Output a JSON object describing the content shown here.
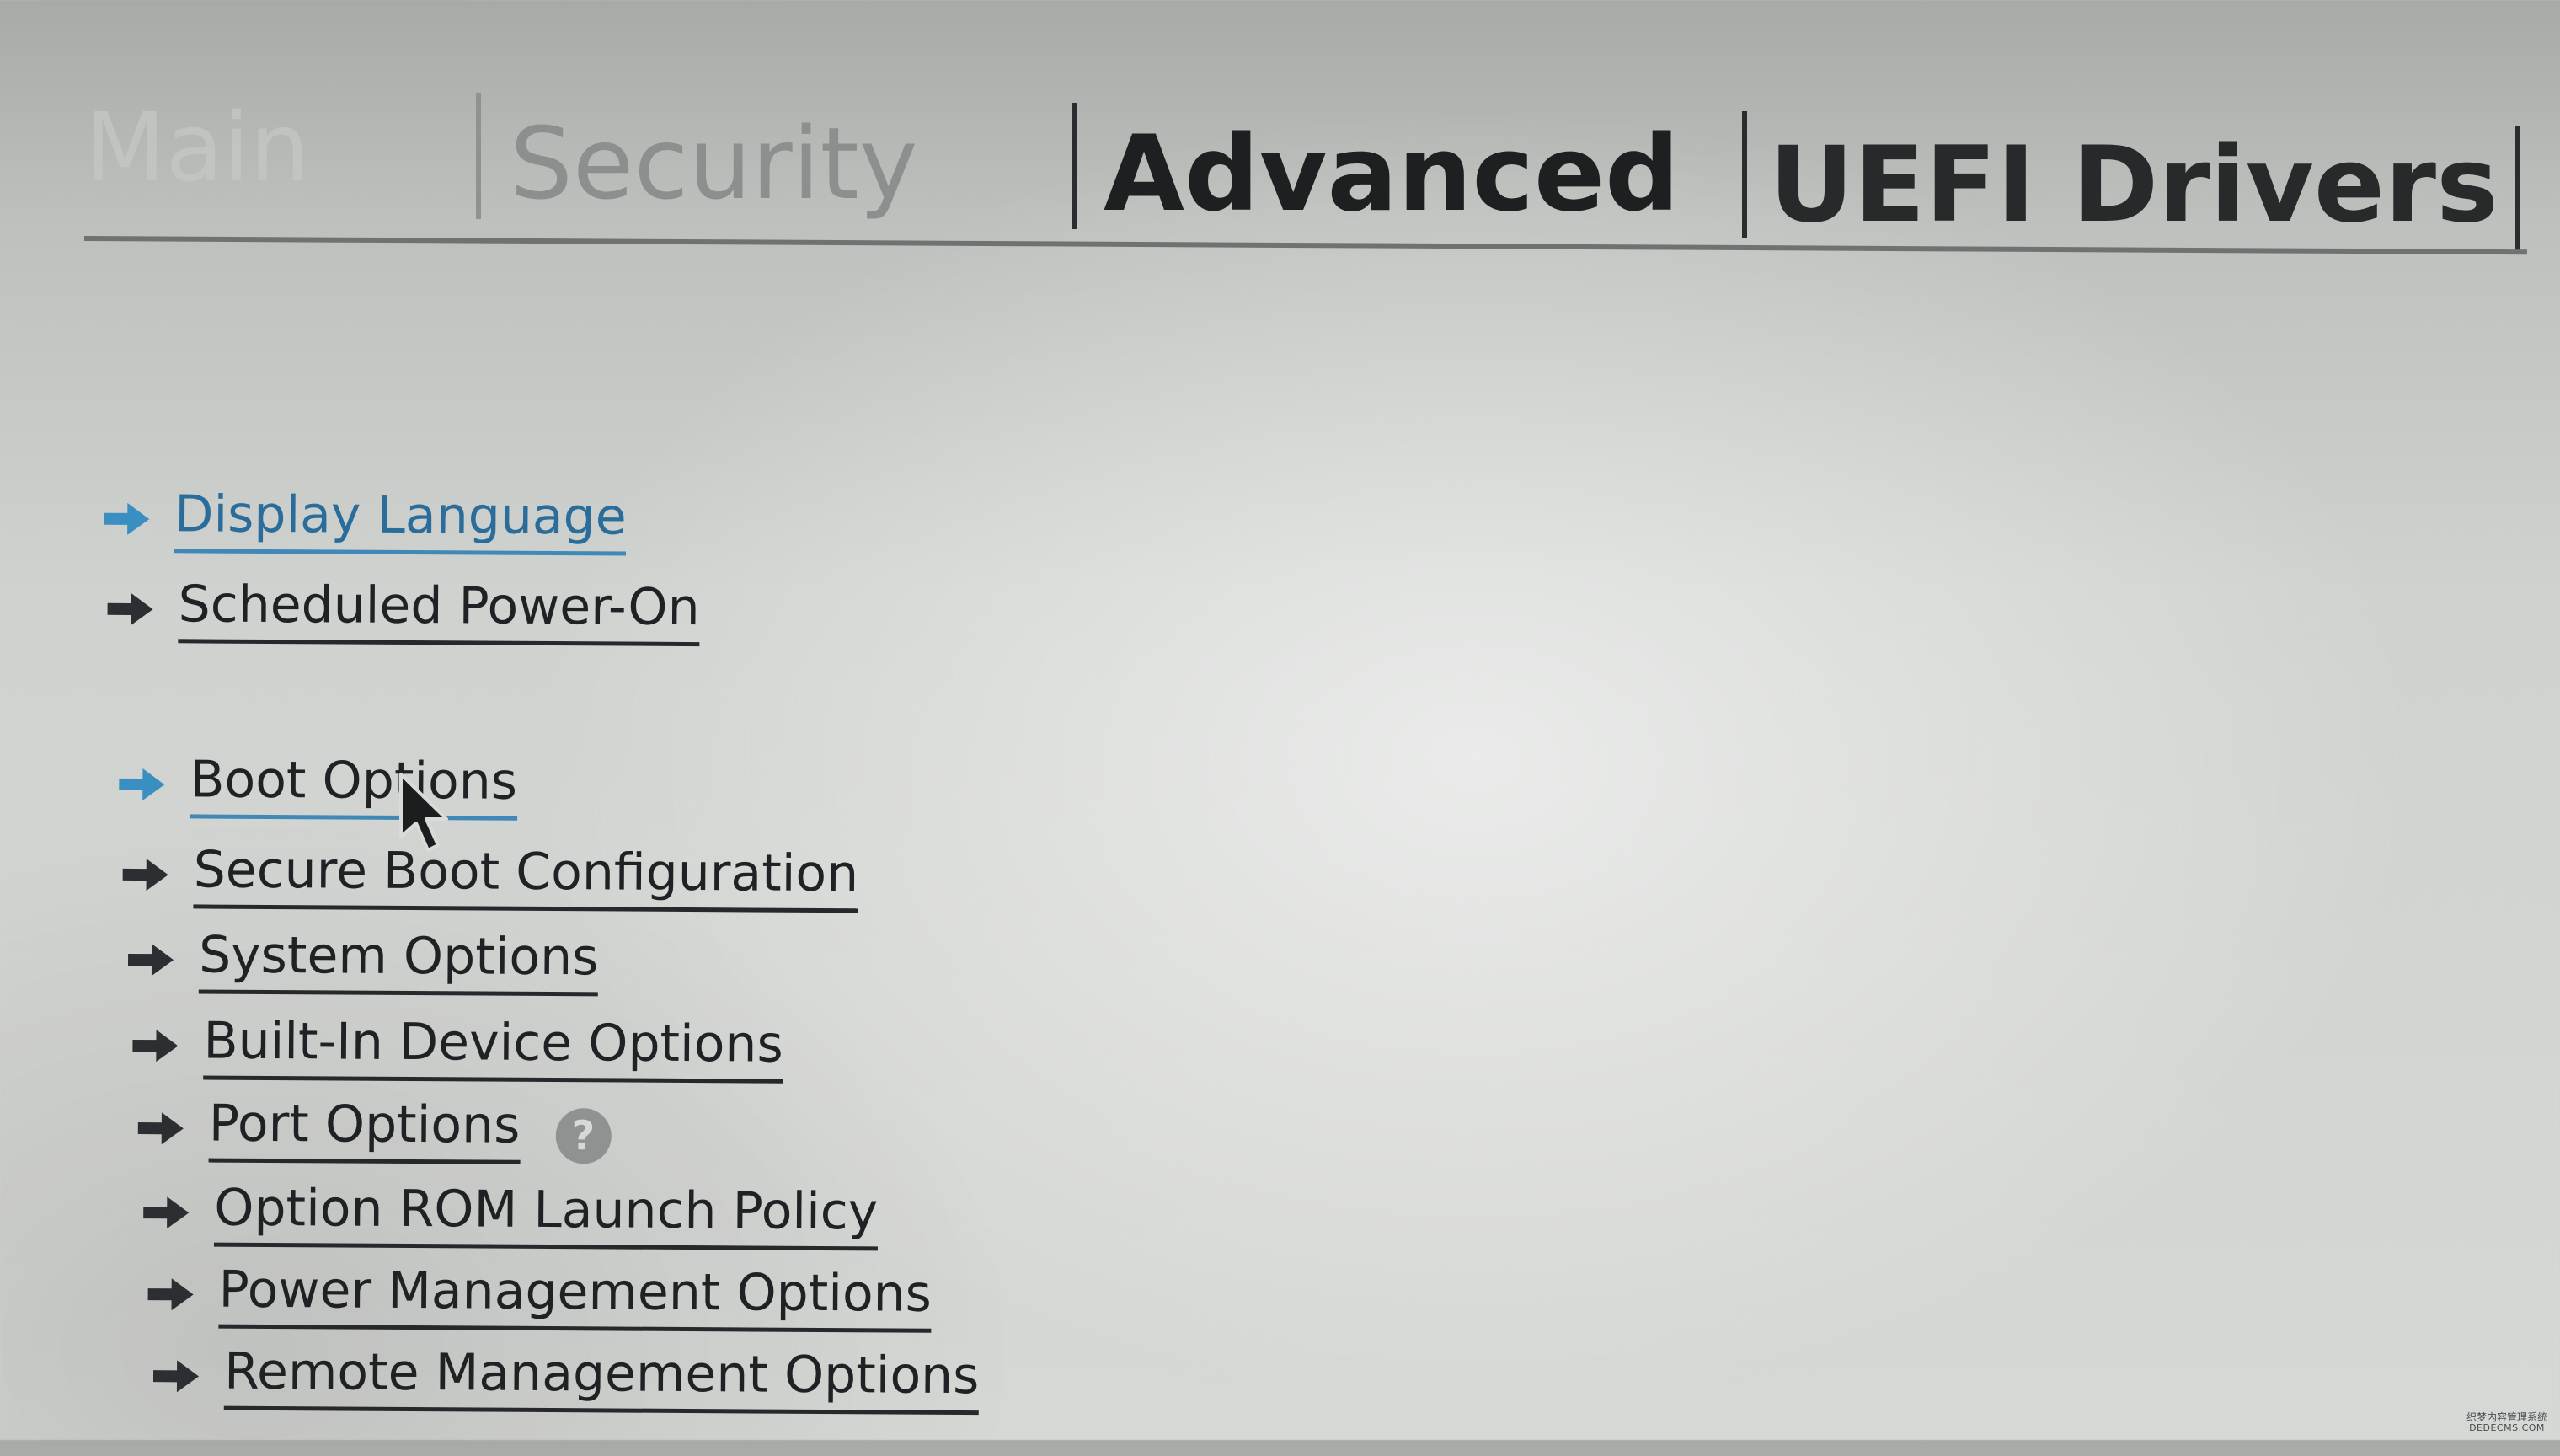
{
  "tabs": [
    {
      "label": "Main",
      "state": "inactive"
    },
    {
      "label": "Security",
      "state": "inactive"
    },
    {
      "label": "Advanced",
      "state": "active"
    },
    {
      "label": "UEFI Drivers",
      "state": "inactive"
    }
  ],
  "menu": {
    "items": [
      {
        "label": "Display Language",
        "arrow_icon": "right-arrow-icon",
        "highlighted": true
      },
      {
        "label": "Scheduled Power-On",
        "arrow_icon": "right-arrow-icon",
        "highlighted": false
      },
      {
        "label": "Boot Options",
        "arrow_icon": "right-arrow-icon",
        "highlighted": false,
        "arrow_highlighted": true
      },
      {
        "label": "Secure Boot Configuration",
        "arrow_icon": "right-arrow-icon",
        "highlighted": false
      },
      {
        "label": "System Options",
        "arrow_icon": "right-arrow-icon",
        "highlighted": false
      },
      {
        "label": "Built-In Device Options",
        "arrow_icon": "right-arrow-icon",
        "highlighted": false
      },
      {
        "label": "Port Options",
        "arrow_icon": "right-arrow-icon",
        "highlighted": false,
        "help_icon": "help-icon",
        "help_glyph": "?"
      },
      {
        "label": "Option ROM Launch Policy",
        "arrow_icon": "right-arrow-icon",
        "highlighted": false
      },
      {
        "label": "Power Management Options",
        "arrow_icon": "right-arrow-icon",
        "highlighted": false
      },
      {
        "label": "Remote Management Options",
        "arrow_icon": "right-arrow-icon",
        "highlighted": false
      }
    ]
  },
  "watermark": {
    "line1": "织梦内容管理系统",
    "line2": "DEDECMS.COM"
  },
  "colors": {
    "accent_blue": "#3f88b8",
    "text_dark": "#1f2224",
    "arrow_dark": "#2c2f31",
    "background": "#d3d5d2"
  }
}
